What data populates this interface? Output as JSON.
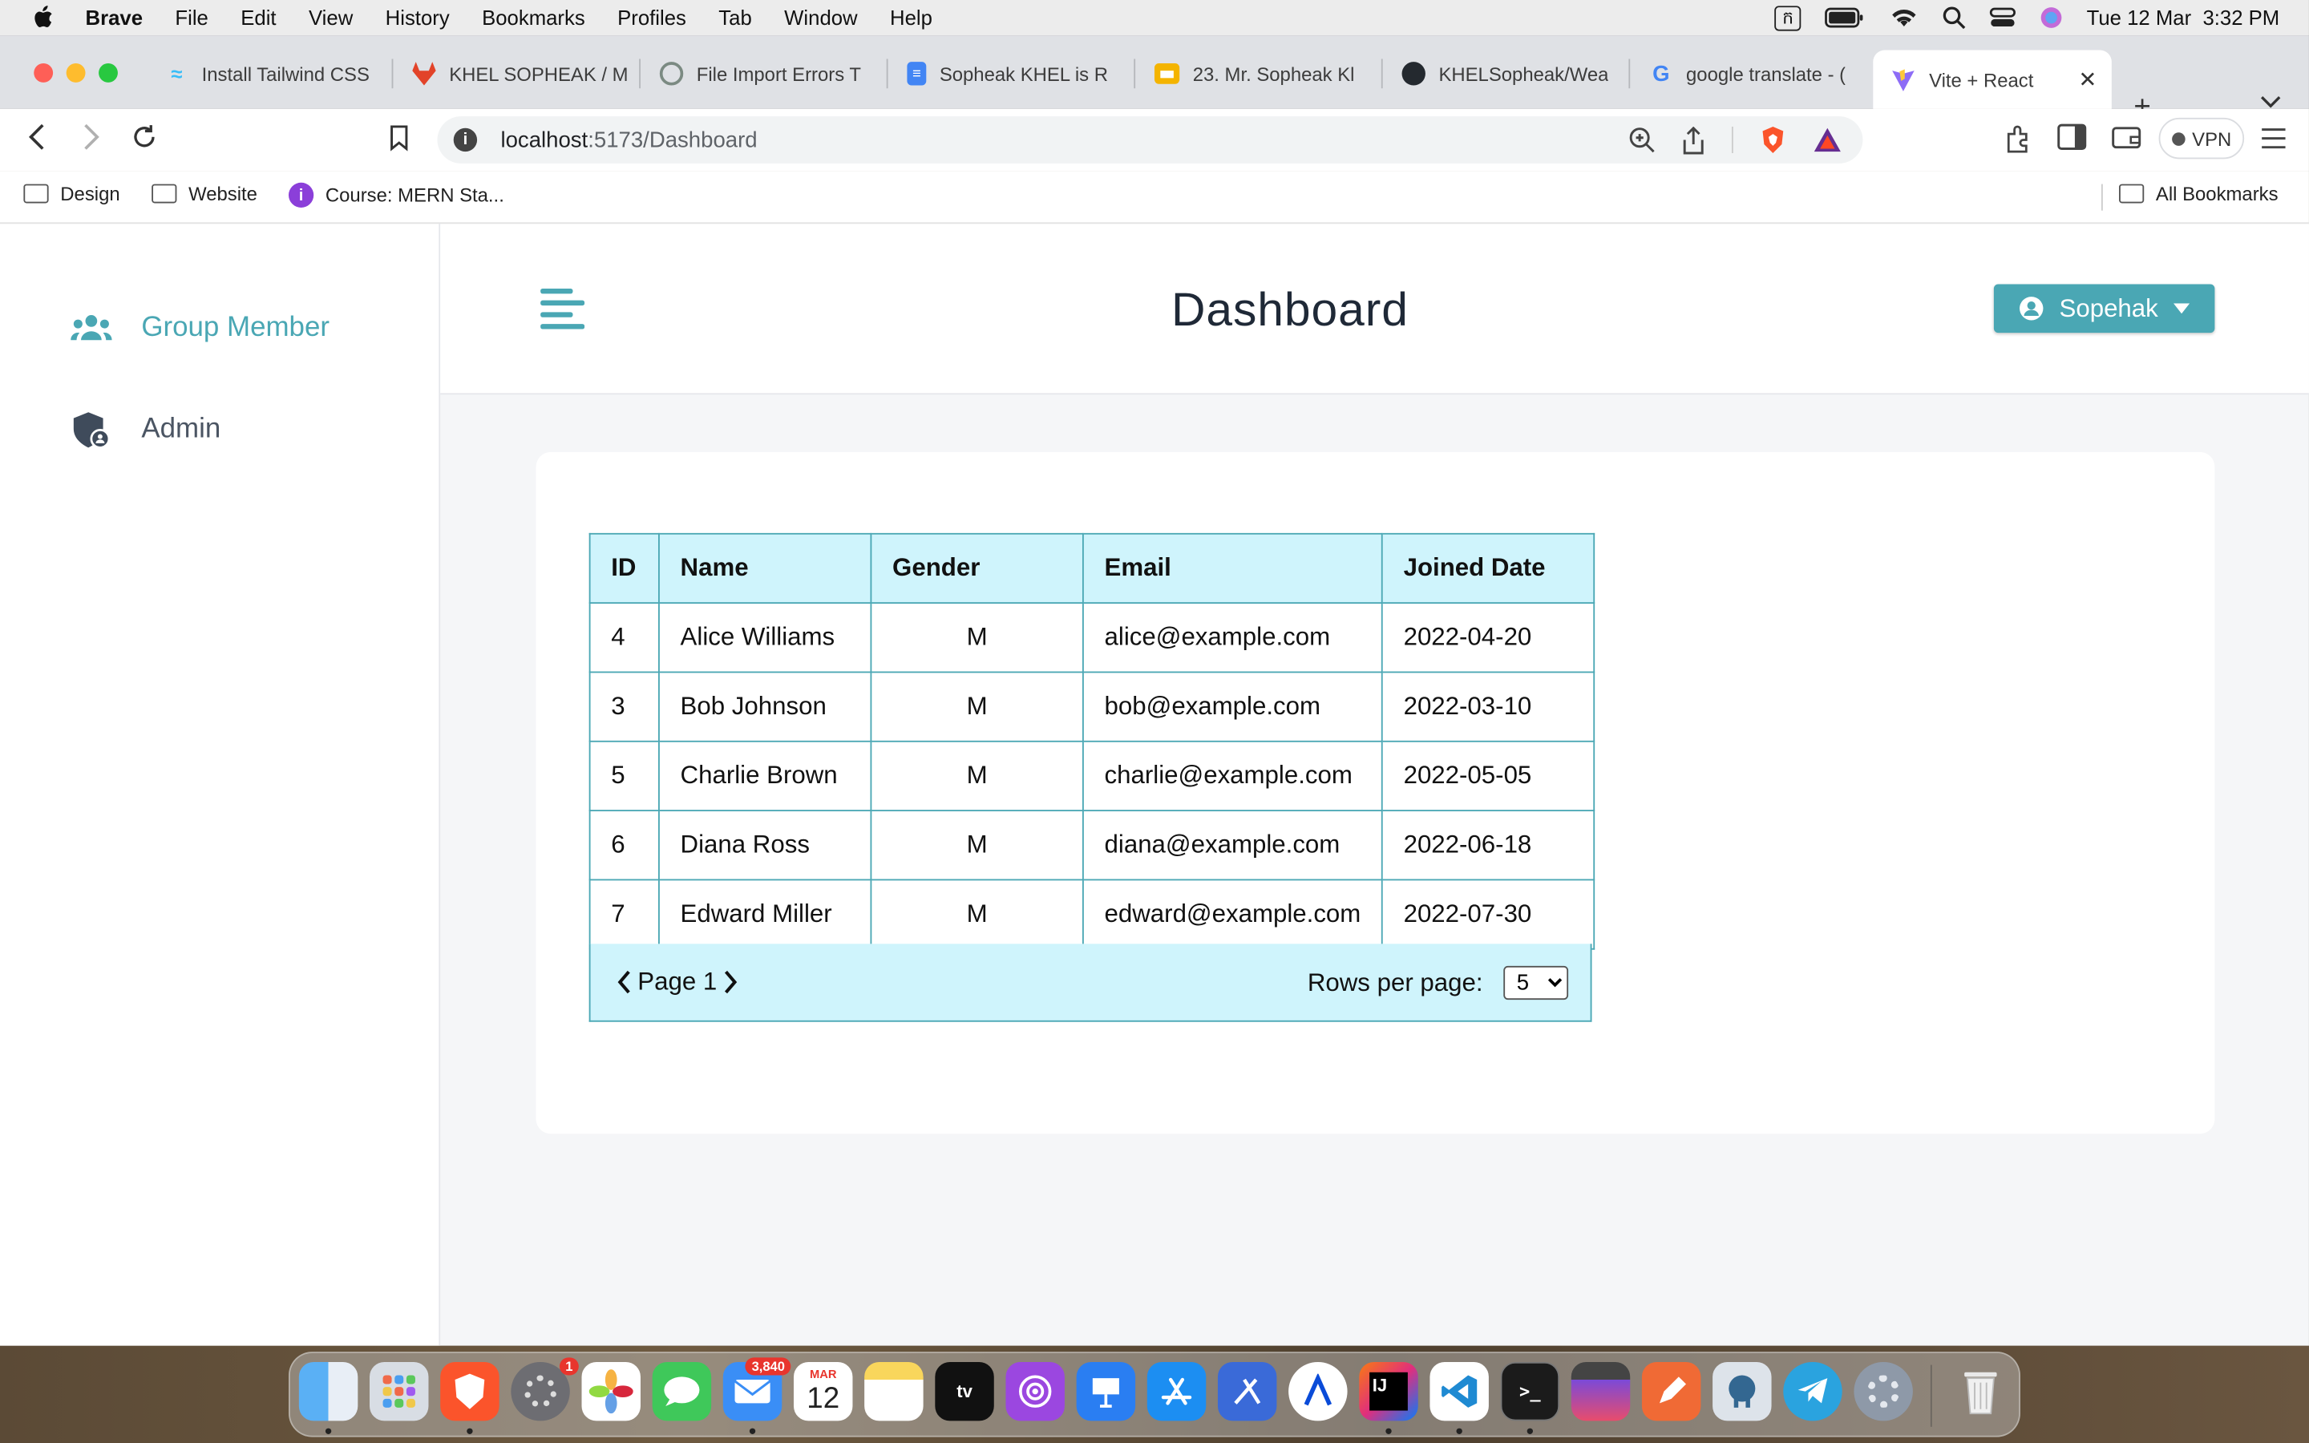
{
  "menubar": {
    "app": "Brave",
    "items": [
      "File",
      "Edit",
      "View",
      "History",
      "Bookmarks",
      "Profiles",
      "Tab",
      "Window",
      "Help"
    ],
    "input_indicator": "ក",
    "datetime": "Tue 12 Mar  3:32 PM"
  },
  "tabs": [
    {
      "label": "Install Tailwind CSS",
      "icon": "tailwind-icon",
      "color": "#38bdf8"
    },
    {
      "label": "KHEL SOPHEAK / M",
      "icon": "gitlab-icon",
      "color": "#e24329"
    },
    {
      "label": "File Import Errors T",
      "icon": "chatgpt-icon",
      "color": "#10a37f"
    },
    {
      "label": "Sopheak KHEL is R",
      "icon": "docs-icon",
      "color": "#4285f4"
    },
    {
      "label": "23. Mr. Sopheak Kl",
      "icon": "slides-icon",
      "color": "#f4b400"
    },
    {
      "label": "KHELSopheak/Wea",
      "icon": "github-icon",
      "color": "#24292f"
    },
    {
      "label": "google translate - (",
      "icon": "google-icon",
      "color": "#4285f4"
    }
  ],
  "active_tab": {
    "label": "Vite + React",
    "icon": "vite-icon"
  },
  "address": {
    "host": "localhost",
    "path": ":5173/Dashboard"
  },
  "vpn_label": "VPN",
  "bookmarks": [
    {
      "label": "Design",
      "icon": "folder-icon"
    },
    {
      "label": "Website",
      "icon": "folder-icon"
    },
    {
      "label": "Course: MERN Sta...",
      "icon": "course-icon"
    }
  ],
  "all_bookmarks": "All Bookmarks",
  "sidebar": {
    "items": [
      {
        "label": "Group Member",
        "icon": "users-icon",
        "active": true
      },
      {
        "label": "Admin",
        "icon": "shield-user-icon",
        "active": false
      }
    ]
  },
  "header": {
    "title": "Dashboard",
    "user": "Sopehak"
  },
  "table": {
    "columns": [
      "ID",
      "Name",
      "Gender",
      "Email",
      "Joined Date"
    ],
    "rows": [
      [
        "4",
        "Alice Williams",
        "M",
        "alice@example.com",
        "2022-04-20"
      ],
      [
        "3",
        "Bob Johnson",
        "M",
        "bob@example.com",
        "2022-03-10"
      ],
      [
        "5",
        "Charlie Brown",
        "M",
        "charlie@example.com",
        "2022-05-05"
      ],
      [
        "6",
        "Diana Ross",
        "M",
        "diana@example.com",
        "2022-06-18"
      ],
      [
        "7",
        "Edward Miller",
        "M",
        "edward@example.com",
        "2022-07-30"
      ]
    ]
  },
  "pagination": {
    "page_label": "Page 1",
    "rows_label": "Rows per page:",
    "rows_value": "5"
  },
  "dock": {
    "mail_badge": "3,840",
    "settings_badge": "1",
    "calendar_month": "MAR",
    "calendar_day": "12"
  },
  "colors": {
    "accent": "#4aa7b4",
    "table_header": "#cff4fc"
  }
}
